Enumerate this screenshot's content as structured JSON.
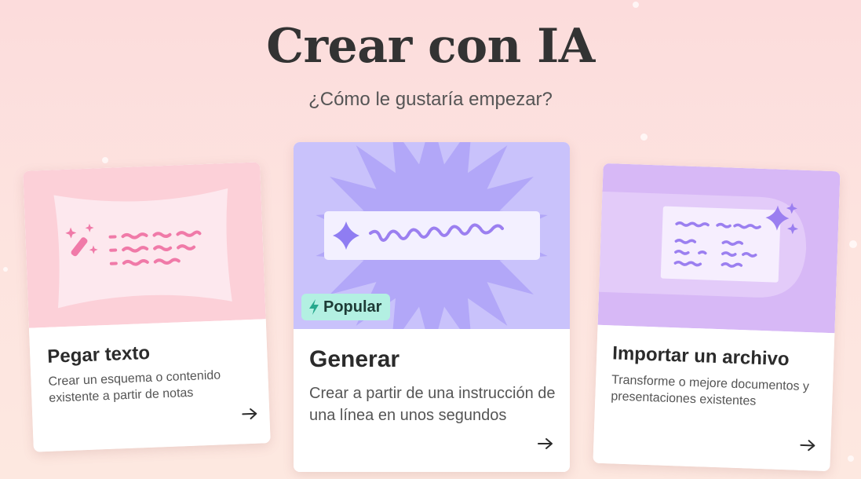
{
  "header": {
    "title": "Crear con IA",
    "subtitle": "¿Cómo le gustaría empezar?"
  },
  "cards": [
    {
      "title": "Pegar texto",
      "description": "Crear un esquema o contenido existente a partir de notas",
      "art_color": "#fcd0d8",
      "icon": "magic-wand-icon"
    },
    {
      "title": "Generar",
      "description": "Crear a partir de una instrucción de una línea en unos segundos",
      "badge": "Popular",
      "art_color": "#c9c2fb",
      "icon": "sparkle-icon"
    },
    {
      "title": "Importar un archivo",
      "description": "Transforme o mejore documentos y presentaciones existentes",
      "art_color": "#d7b8f6",
      "icon": "sparkles-icon"
    }
  ],
  "colors": {
    "badge_bg": "#b3f0e2",
    "pink_scribble": "#f07aa8",
    "purple_scribble": "#9b7ff0"
  }
}
